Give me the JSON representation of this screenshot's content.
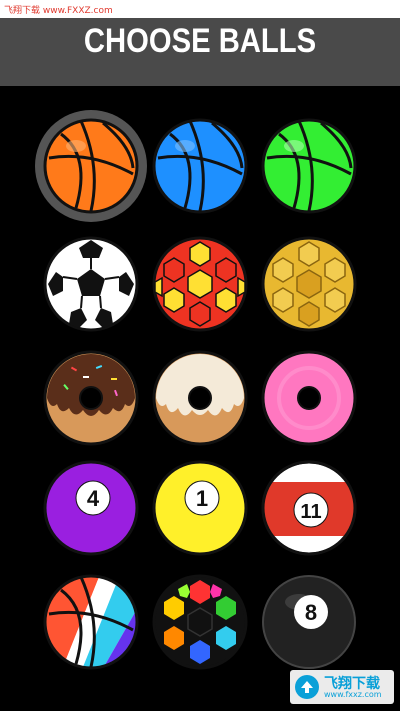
{
  "header": {
    "title": "CHOOSE BALLS"
  },
  "watermark": {
    "top": "飞翔下载 www.FXXZ.com",
    "bottom_name": "飞翔下载",
    "bottom_url": "www.fxxz.com"
  },
  "balls": [
    {
      "id": "basketball-orange",
      "selected": true,
      "color": "#ff7a1a"
    },
    {
      "id": "basketball-blue",
      "color": "#1e90ff"
    },
    {
      "id": "basketball-green",
      "color": "#33ee33"
    },
    {
      "id": "soccer-white",
      "color": "#ffffff"
    },
    {
      "id": "soccer-red-yellow",
      "color": "#ee3322"
    },
    {
      "id": "soccer-gold",
      "color": "#e8b830"
    },
    {
      "id": "donut-chocolate",
      "color": "#5a2e1a"
    },
    {
      "id": "donut-vanilla",
      "color": "#f4ead8"
    },
    {
      "id": "donut-pink",
      "color": "#ff77c0"
    },
    {
      "id": "pool-ball-4",
      "number": "4",
      "color": "#9a1fe0"
    },
    {
      "id": "pool-ball-1",
      "number": "1",
      "color": "#fff02a"
    },
    {
      "id": "pool-ball-11",
      "number": "11",
      "color": "#e0392a"
    },
    {
      "id": "basketball-rainbow",
      "color": "#ff5533"
    },
    {
      "id": "soccer-rainbow",
      "color": "#33ccee"
    },
    {
      "id": "pool-ball-8",
      "number": "8",
      "color": "#222222"
    }
  ]
}
